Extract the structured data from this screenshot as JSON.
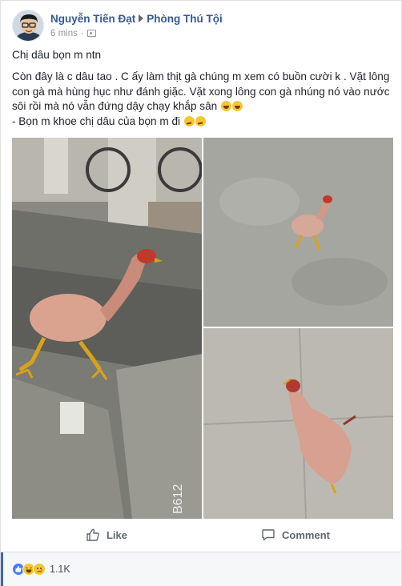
{
  "post": {
    "author": "Nguyễn Tiến Đạt",
    "group": "Phòng Thú Tội",
    "time": "6 mins",
    "audience_icon": "group-audience-icon",
    "text": {
      "line1": "Chị dâu bọn m ntn",
      "line2": "Còn đây là c dâu tao . C ấy làm thịt gà chúng m xem có buồn cười k . Vặt lông con gà mà hùng hục như đánh giặc. Vặt xong lông con gà nhúng nó vào nước sôi rồi mà nó vẫn đứng dậy chạy khắp sân",
      "line3": "- Bọn m khoe chị dâu của bọn m đi"
    },
    "photo_watermark": "B612"
  },
  "actions": {
    "like_label": "Like",
    "comment_label": "Comment"
  },
  "reactions": {
    "types": [
      "like",
      "haha",
      "sad"
    ],
    "count": "1.1K"
  },
  "colors": {
    "link": "#365899",
    "accent": "#4267b2",
    "muted": "#90949c"
  }
}
